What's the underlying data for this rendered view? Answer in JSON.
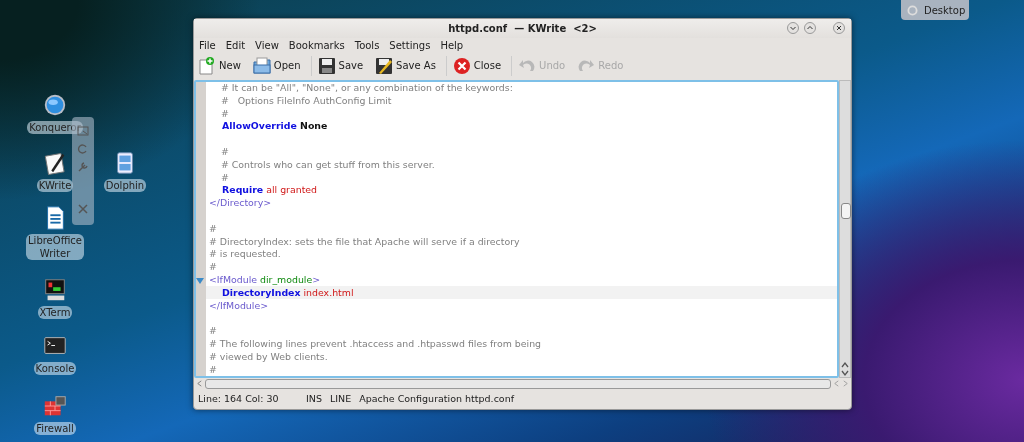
{
  "desktop_icons": [
    {
      "label": "Konqueror",
      "kind": "globe"
    },
    {
      "label": "KWrite",
      "kind": "kwrite"
    },
    {
      "label": "Dolphin",
      "kind": "dolphin"
    },
    {
      "label": "LibreOffice\nWriter",
      "kind": "writer"
    },
    {
      "label": "XTerm",
      "kind": "xterm"
    },
    {
      "label": "Konsole",
      "kind": "konsole"
    },
    {
      "label": "Firewall",
      "kind": "firewall"
    }
  ],
  "desktop_button": {
    "label": "Desktop"
  },
  "window": {
    "title": "httpd.conf  — KWrite  <2>"
  },
  "menu": [
    "File",
    "Edit",
    "View",
    "Bookmarks",
    "Tools",
    "Settings",
    "Help"
  ],
  "toolbar": [
    {
      "label": "New",
      "kind": "new",
      "disabled": false
    },
    {
      "label": "Open",
      "kind": "open",
      "disabled": false
    },
    {
      "label": "Save",
      "kind": "save",
      "disabled": false
    },
    {
      "label": "Save As",
      "kind": "saveas",
      "disabled": false
    },
    {
      "label": "Close",
      "kind": "close",
      "disabled": false
    },
    {
      "label": "Undo",
      "kind": "undo",
      "disabled": true
    },
    {
      "label": "Redo",
      "kind": "redo",
      "disabled": true
    }
  ],
  "editor": {
    "lines": [
      {
        "kind": "code",
        "current": false,
        "fold": false,
        "segments": [
          {
            "kind": "comment",
            "text": "    # It can be \"All\", \"None\", or any combination of the keywords:"
          }
        ]
      },
      {
        "kind": "code",
        "current": false,
        "fold": false,
        "segments": [
          {
            "kind": "comment",
            "text": "    #   Options FileInfo AuthConfig Limit"
          }
        ]
      },
      {
        "kind": "code",
        "current": false,
        "fold": false,
        "segments": [
          {
            "kind": "comment",
            "text": "    #"
          }
        ]
      },
      {
        "kind": "code",
        "current": false,
        "fold": false,
        "segments": [
          {
            "kind": "keyword",
            "text": "    AllowOverride"
          },
          {
            "kind": "plain",
            "text": " None"
          }
        ]
      },
      {
        "kind": "blank"
      },
      {
        "kind": "code",
        "current": false,
        "fold": false,
        "segments": [
          {
            "kind": "comment",
            "text": "    #"
          }
        ]
      },
      {
        "kind": "code",
        "current": false,
        "fold": false,
        "segments": [
          {
            "kind": "comment",
            "text": "    # Controls who can get stuff from this server."
          }
        ]
      },
      {
        "kind": "code",
        "current": false,
        "fold": false,
        "segments": [
          {
            "kind": "comment",
            "text": "    #"
          }
        ]
      },
      {
        "kind": "code",
        "current": false,
        "fold": false,
        "segments": [
          {
            "kind": "keyword",
            "text": "    Require"
          },
          {
            "kind": "value",
            "text": " all granted"
          }
        ]
      },
      {
        "kind": "code",
        "current": false,
        "fold": false,
        "segments": [
          {
            "kind": "tag",
            "text": "</Directory>"
          }
        ]
      },
      {
        "kind": "blank"
      },
      {
        "kind": "code",
        "current": false,
        "fold": false,
        "segments": [
          {
            "kind": "comment",
            "text": "#"
          }
        ]
      },
      {
        "kind": "code",
        "current": false,
        "fold": false,
        "segments": [
          {
            "kind": "comment",
            "text": "# DirectoryIndex: sets the file that Apache will serve if a directory"
          }
        ]
      },
      {
        "kind": "code",
        "current": false,
        "fold": false,
        "segments": [
          {
            "kind": "comment",
            "text": "# is requested."
          }
        ]
      },
      {
        "kind": "code",
        "current": false,
        "fold": false,
        "segments": [
          {
            "kind": "comment",
            "text": "#"
          }
        ]
      },
      {
        "kind": "code",
        "current": false,
        "fold": true,
        "segments": [
          {
            "kind": "tag",
            "text": "<IfModule"
          },
          {
            "kind": "module",
            "text": " dir_module"
          },
          {
            "kind": "tag",
            "text": ">"
          }
        ]
      },
      {
        "kind": "code",
        "current": true,
        "fold": false,
        "segments": [
          {
            "kind": "keyword",
            "text": "    DirectoryIndex"
          },
          {
            "kind": "value",
            "text": " index.html"
          }
        ]
      },
      {
        "kind": "code",
        "current": false,
        "fold": false,
        "segments": [
          {
            "kind": "tag",
            "text": "</IfModule>"
          }
        ]
      },
      {
        "kind": "blank"
      },
      {
        "kind": "code",
        "current": false,
        "fold": false,
        "segments": [
          {
            "kind": "comment",
            "text": "#"
          }
        ]
      },
      {
        "kind": "code",
        "current": false,
        "fold": false,
        "segments": [
          {
            "kind": "comment",
            "text": "# The following lines prevent .htaccess and .htpasswd files from being"
          }
        ]
      },
      {
        "kind": "code",
        "current": false,
        "fold": false,
        "segments": [
          {
            "kind": "comment",
            "text": "# viewed by Web clients."
          }
        ]
      },
      {
        "kind": "code",
        "current": false,
        "fold": false,
        "segments": [
          {
            "kind": "comment",
            "text": "#"
          }
        ]
      }
    ]
  },
  "status_bar": {
    "position": "Line: 164 Col: 30",
    "mode": "INS",
    "selection": "LINE",
    "file_type": "Apache Configuration httpd.conf"
  }
}
